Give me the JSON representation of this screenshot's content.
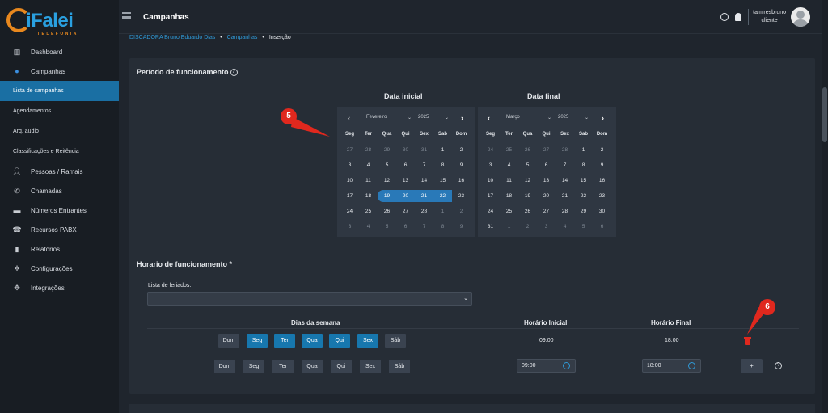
{
  "brand": {
    "name": "iFalei",
    "sub": "TELEFONIA"
  },
  "sidebar": {
    "items": [
      {
        "label": "Dashboard",
        "icon": "chart-icon"
      },
      {
        "label": "Campanhas",
        "icon": "globe-icon"
      },
      {
        "label": "Lista de campanhas",
        "sub": true,
        "active": true
      },
      {
        "label": "Agendamentos",
        "sub": true
      },
      {
        "label": "Arq. audio",
        "sub": true
      },
      {
        "label": "Classificações e Reitência",
        "sub": true
      },
      {
        "label": "Pessoas / Ramais",
        "icon": "user-icon"
      },
      {
        "label": "Chamadas",
        "icon": "phone-icon"
      },
      {
        "label": "Números Entrantes",
        "icon": "numbers-icon"
      },
      {
        "label": "Recursos PABX",
        "icon": "pabx-icon"
      },
      {
        "label": "Relatórios",
        "icon": "report-icon"
      },
      {
        "label": "Configurações",
        "icon": "gear-icon"
      },
      {
        "label": "Integrações",
        "icon": "integration-icon"
      }
    ]
  },
  "header": {
    "title": "Campanhas",
    "user": "tamiresbruno",
    "role": "cliente"
  },
  "breadcrumb": {
    "a": "DISCADORA Bruno Eduardo Dias",
    "b": "Campanhas",
    "c": "Inserção",
    "sep": "•"
  },
  "period": {
    "title": "Período de funcionamento",
    "start_label": "Data inicial",
    "end_label": "Data final"
  },
  "calendar_start": {
    "month": "Fevereiro",
    "year": "2025",
    "dows": [
      "Seg",
      "Ter",
      "Qua",
      "Qui",
      "Sex",
      "Sab",
      "Dom"
    ],
    "weeks": [
      [
        "27",
        "28",
        "29",
        "30",
        "31",
        "1",
        "2"
      ],
      [
        "3",
        "4",
        "5",
        "6",
        "7",
        "8",
        "9"
      ],
      [
        "10",
        "11",
        "12",
        "13",
        "14",
        "15",
        "16"
      ],
      [
        "17",
        "18",
        "19",
        "20",
        "21",
        "22",
        "23"
      ],
      [
        "24",
        "25",
        "26",
        "27",
        "28",
        "1",
        "2"
      ],
      [
        "3",
        "4",
        "5",
        "6",
        "7",
        "8",
        "9"
      ]
    ]
  },
  "calendar_end": {
    "month": "Março",
    "year": "2025",
    "dows": [
      "Seg",
      "Ter",
      "Qua",
      "Qui",
      "Sex",
      "Sab",
      "Dom"
    ],
    "weeks": [
      [
        "24",
        "25",
        "26",
        "27",
        "28",
        "1",
        "2"
      ],
      [
        "3",
        "4",
        "5",
        "6",
        "7",
        "8",
        "9"
      ],
      [
        "10",
        "11",
        "12",
        "13",
        "14",
        "15",
        "16"
      ],
      [
        "17",
        "18",
        "19",
        "20",
        "21",
        "22",
        "23"
      ],
      [
        "24",
        "25",
        "26",
        "27",
        "28",
        "29",
        "30"
      ],
      [
        "31",
        "1",
        "2",
        "3",
        "4",
        "5",
        "6"
      ]
    ]
  },
  "annotations": {
    "a": "5",
    "b": "6"
  },
  "schedule": {
    "title": "Horario de funcionamento *",
    "holiday_label": "Lista de feriados:",
    "col_days": "Dias da semana",
    "col_start": "Horário Inicial",
    "col_end": "Horário Final",
    "days": [
      "Dom",
      "Seg",
      "Ter",
      "Qua",
      "Qui",
      "Sex",
      "Sáb"
    ],
    "row_start": "09:00",
    "row_end": "18:00",
    "input_start": "09:00",
    "input_end": "18:00",
    "add": "+",
    "help": "?"
  },
  "colors": {
    "accent": "#1777ae",
    "range": "#2979b8",
    "danger": "#e0281e"
  }
}
